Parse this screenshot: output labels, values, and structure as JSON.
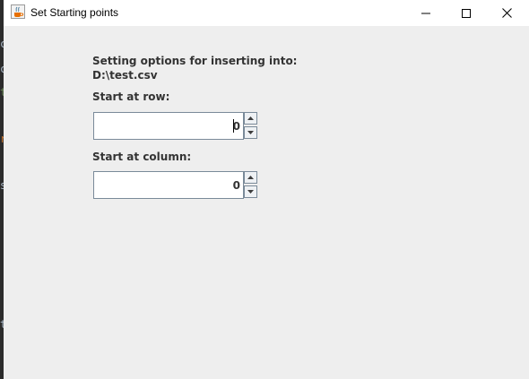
{
  "window": {
    "title": "Set Starting points"
  },
  "dialog": {
    "heading_line1": "Setting options for inserting into:",
    "heading_line2": "D:\\test.csv",
    "row_label": "Start at row:",
    "row_value": "0",
    "column_label": "Start at column:",
    "column_value": "0"
  },
  "background_editor": {
    "glyphs": [
      "c",
      "c",
      "t",
      "r",
      "s",
      "t"
    ]
  },
  "colors": {
    "window_bg": "#eeeeee",
    "titlebar_bg": "#ffffff",
    "label_text": "#333333",
    "field_border": "#7a8a99"
  },
  "icons": {
    "app": "java-cup-icon",
    "minimize": "minimize-icon",
    "maximize": "maximize-icon",
    "close": "close-icon",
    "spin_up": "arrow-up-icon",
    "spin_down": "arrow-down-icon"
  }
}
